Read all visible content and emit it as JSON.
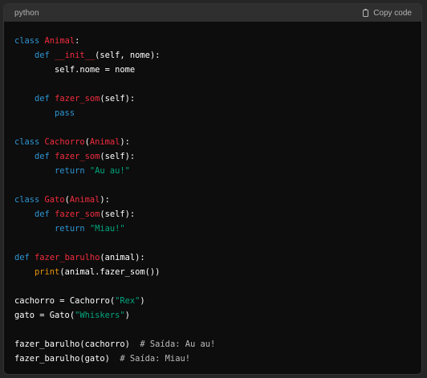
{
  "header": {
    "language": "python",
    "copy_label": "Copy code"
  },
  "colors": {
    "keyword": "#2e95d3",
    "name": "#f22c3d",
    "string": "#00a67d",
    "comment": "#bdbdbd",
    "builtin": "#e9950c",
    "plain": "#ffffff"
  },
  "code_lines": [
    [
      [
        "kw",
        "class"
      ],
      [
        "plain",
        " "
      ],
      [
        "name",
        "Animal"
      ],
      [
        "plain",
        ":"
      ]
    ],
    [
      [
        "plain",
        "    "
      ],
      [
        "kw",
        "def"
      ],
      [
        "plain",
        " "
      ],
      [
        "name",
        "__init__"
      ],
      [
        "plain",
        "(self, nome):"
      ]
    ],
    [
      [
        "plain",
        "        self.nome = nome"
      ]
    ],
    [],
    [
      [
        "plain",
        "    "
      ],
      [
        "kw",
        "def"
      ],
      [
        "plain",
        " "
      ],
      [
        "name",
        "fazer_som"
      ],
      [
        "plain",
        "(self):"
      ]
    ],
    [
      [
        "plain",
        "        "
      ],
      [
        "kw",
        "pass"
      ]
    ],
    [],
    [
      [
        "kw",
        "class"
      ],
      [
        "plain",
        " "
      ],
      [
        "name",
        "Cachorro"
      ],
      [
        "plain",
        "("
      ],
      [
        "name",
        "Animal"
      ],
      [
        "plain",
        "):"
      ]
    ],
    [
      [
        "plain",
        "    "
      ],
      [
        "kw",
        "def"
      ],
      [
        "plain",
        " "
      ],
      [
        "name",
        "fazer_som"
      ],
      [
        "plain",
        "(self):"
      ]
    ],
    [
      [
        "plain",
        "        "
      ],
      [
        "kw",
        "return"
      ],
      [
        "plain",
        " "
      ],
      [
        "str",
        "\"Au au!\""
      ]
    ],
    [],
    [
      [
        "kw",
        "class"
      ],
      [
        "plain",
        " "
      ],
      [
        "name",
        "Gato"
      ],
      [
        "plain",
        "("
      ],
      [
        "name",
        "Animal"
      ],
      [
        "plain",
        "):"
      ]
    ],
    [
      [
        "plain",
        "    "
      ],
      [
        "kw",
        "def"
      ],
      [
        "plain",
        " "
      ],
      [
        "name",
        "fazer_som"
      ],
      [
        "plain",
        "(self):"
      ]
    ],
    [
      [
        "plain",
        "        "
      ],
      [
        "kw",
        "return"
      ],
      [
        "plain",
        " "
      ],
      [
        "str",
        "\"Miau!\""
      ]
    ],
    [],
    [
      [
        "kw",
        "def"
      ],
      [
        "plain",
        " "
      ],
      [
        "name",
        "fazer_barulho"
      ],
      [
        "plain",
        "(animal):"
      ]
    ],
    [
      [
        "plain",
        "    "
      ],
      [
        "fn",
        "print"
      ],
      [
        "plain",
        "(animal.fazer_som())"
      ]
    ],
    [],
    [
      [
        "plain",
        "cachorro = Cachorro("
      ],
      [
        "str",
        "\"Rex\""
      ],
      [
        "plain",
        ")"
      ]
    ],
    [
      [
        "plain",
        "gato = Gato("
      ],
      [
        "str",
        "\"Whiskers\""
      ],
      [
        "plain",
        ")"
      ]
    ],
    [],
    [
      [
        "plain",
        "fazer_barulho(cachorro)  "
      ],
      [
        "cmt",
        "# Saída: Au au!"
      ]
    ],
    [
      [
        "plain",
        "fazer_barulho(gato)  "
      ],
      [
        "cmt",
        "# Saída: Miau!"
      ]
    ]
  ]
}
